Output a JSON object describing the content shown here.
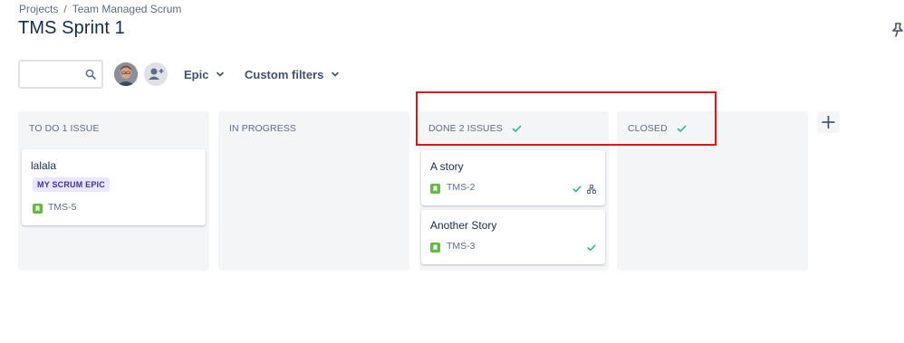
{
  "breadcrumb": {
    "projects": "Projects",
    "separator": "/",
    "project": "Team Managed Scrum"
  },
  "page": {
    "title": "TMS Sprint 1"
  },
  "toolbar": {
    "search": {
      "value": "",
      "placeholder": ""
    },
    "filters": {
      "epic": "Epic",
      "custom": "Custom filters"
    }
  },
  "columns": [
    {
      "name": "TO DO 1 ISSUE",
      "done": false,
      "cards": [
        {
          "title": "lalala",
          "epic": "MY SCRUM EPIC",
          "key": "TMS-5",
          "done": false,
          "has_children": false
        }
      ]
    },
    {
      "name": "IN PROGRESS",
      "done": false,
      "cards": []
    },
    {
      "name": "DONE 2 ISSUES",
      "done": true,
      "cards": [
        {
          "title": "A story",
          "key": "TMS-2",
          "done": true,
          "has_children": true
        },
        {
          "title": "Another Story",
          "key": "TMS-3",
          "done": true,
          "has_children": false
        }
      ]
    },
    {
      "name": "CLOSED",
      "done": true,
      "cards": []
    }
  ],
  "colors": {
    "story_icon": "#63ba3c",
    "done_check": "#36b37e",
    "epic_bg": "#eae6ff",
    "epic_text": "#403294",
    "highlight": "#e6130f",
    "column_bg": "#f4f5f7"
  },
  "icons": {
    "search": "search-icon",
    "add_people": "add-person-icon",
    "story": "story-bookmark-icon",
    "check": "check-icon",
    "child_issues": "child-issues-icon",
    "add_column": "plus-icon",
    "pin": "pin-icon"
  }
}
